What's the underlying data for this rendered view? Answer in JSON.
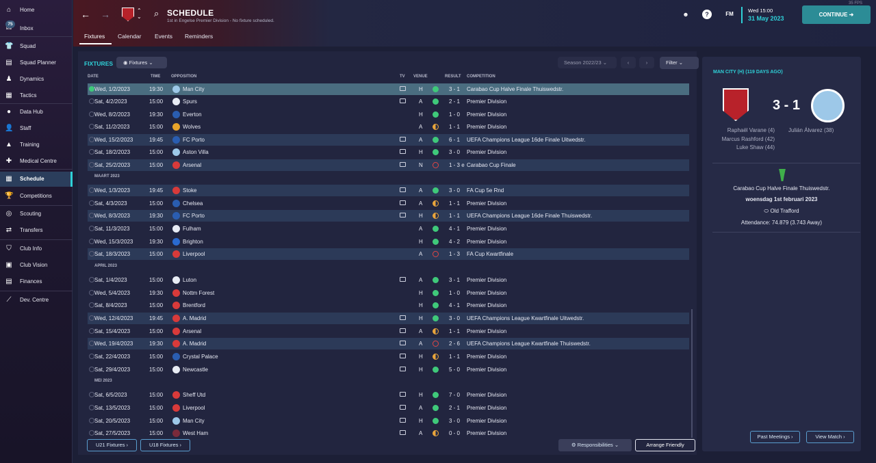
{
  "sidebar": {
    "inbox_badge": "75",
    "items": [
      {
        "label": "Home",
        "icon": "home-icon",
        "glyph": "⌂"
      },
      {
        "label": "Inbox",
        "icon": "inbox-icon",
        "glyph": "✉"
      },
      {
        "label": "Squad",
        "icon": "shirt-icon",
        "glyph": "👕"
      },
      {
        "label": "Squad Planner",
        "icon": "planner-icon",
        "glyph": "▤"
      },
      {
        "label": "Dynamics",
        "icon": "dynamics-icon",
        "glyph": "♟"
      },
      {
        "label": "Tactics",
        "icon": "tactics-icon",
        "glyph": "▦"
      },
      {
        "label": "Data Hub",
        "icon": "data-hub-icon",
        "glyph": "●"
      },
      {
        "label": "Staff",
        "icon": "staff-icon",
        "glyph": "👤"
      },
      {
        "label": "Training",
        "icon": "training-icon",
        "glyph": "▲"
      },
      {
        "label": "Medical Centre",
        "icon": "medical-icon",
        "glyph": "✚"
      },
      {
        "label": "Schedule",
        "icon": "calendar-icon",
        "glyph": "▦"
      },
      {
        "label": "Competitions",
        "icon": "trophy-icon",
        "glyph": "🏆"
      },
      {
        "label": "Scouting",
        "icon": "scouting-icon",
        "glyph": "◎"
      },
      {
        "label": "Transfers",
        "icon": "transfers-icon",
        "glyph": "⇄"
      },
      {
        "label": "Club Info",
        "icon": "shield-icon",
        "glyph": "⛉"
      },
      {
        "label": "Club Vision",
        "icon": "vision-icon",
        "glyph": "▣"
      },
      {
        "label": "Finances",
        "icon": "finances-icon",
        "glyph": "▤"
      },
      {
        "label": "Dev. Centre",
        "icon": "dev-centre-icon",
        "glyph": "⟋"
      }
    ]
  },
  "header": {
    "title": "SCHEDULE",
    "subtitle": "1st in Engelse Premier Division - No fixture scheduled.",
    "tabs": [
      "Fixtures",
      "Calendar",
      "Events",
      "Reminders"
    ],
    "date_day": "Wed 15:00",
    "date_full": "31 May 2023",
    "continue_label": "CONTINUE",
    "fps": "35 FPS",
    "fm_label": "FM",
    "help_label": "?"
  },
  "fixtures": {
    "section_title": "FIXTURES",
    "view_select": "Fixtures",
    "season_select": "Season 2022/23",
    "filter_label": "Filter",
    "columns": {
      "date": "DATE",
      "time": "TIME",
      "opposition": "OPPOSITION",
      "tv": "TV",
      "venue": "VENUE",
      "result": "RESULT",
      "competition": "COMPETITION"
    },
    "months": [
      "MAART 2023",
      "APRIL 2023",
      "MEI 2023"
    ],
    "rows": [
      {
        "date": "Wed, 1/2/2023",
        "time": "19:30",
        "opp": "Man City",
        "tv": true,
        "venue": "H",
        "res": "W",
        "score": "3 - 1",
        "comp": "Carabao Cup Halve Finale Thuiswedstr.",
        "color": "#9dc8e8"
      },
      {
        "date": "Sat, 4/2/2023",
        "time": "15:00",
        "opp": "Spurs",
        "tv": true,
        "venue": "A",
        "res": "W",
        "score": "2 - 1",
        "comp": "Premier Division",
        "color": "#e8ecf4"
      },
      {
        "date": "Wed, 8/2/2023",
        "time": "19:30",
        "opp": "Everton",
        "tv": false,
        "venue": "H",
        "res": "W",
        "score": "1 - 0",
        "comp": "Premier Division",
        "color": "#2a5db0"
      },
      {
        "date": "Sat, 11/2/2023",
        "time": "15:00",
        "opp": "Wolves",
        "tv": false,
        "venue": "A",
        "res": "D",
        "score": "1 - 1",
        "comp": "Premier Division",
        "color": "#e8a42a"
      },
      {
        "date": "Wed, 15/2/2023",
        "time": "19:45",
        "opp": "FC Porto",
        "tv": true,
        "venue": "A",
        "res": "W",
        "score": "6 - 1",
        "comp": "UEFA Champions League 16de Finale  Uitwedstr.",
        "color": "#2a5db0"
      },
      {
        "date": "Sat, 18/2/2023",
        "time": "15:00",
        "opp": "Aston Villa",
        "tv": true,
        "venue": "H",
        "res": "W",
        "score": "3 - 0",
        "comp": "Premier Division",
        "color": "#9dc8e8"
      },
      {
        "date": "Sat, 25/2/2023",
        "time": "15:00",
        "opp": "Arsenal",
        "tv": true,
        "venue": "N",
        "res": "L",
        "score": "1 - 3 e",
        "comp": "Carabao Cup Finale",
        "color": "#d83a3a"
      },
      {
        "date": "Wed, 1/3/2023",
        "time": "19:45",
        "opp": "Stoke",
        "tv": true,
        "venue": "A",
        "res": "W",
        "score": "3 - 0",
        "comp": "FA Cup 5e Rnd",
        "color": "#d83a3a"
      },
      {
        "date": "Sat, 4/3/2023",
        "time": "15:00",
        "opp": "Chelsea",
        "tv": true,
        "venue": "A",
        "res": "D",
        "score": "1 - 1",
        "comp": "Premier Division",
        "color": "#2a5db0"
      },
      {
        "date": "Wed, 8/3/2023",
        "time": "19:30",
        "opp": "FC Porto",
        "tv": true,
        "venue": "H",
        "res": "D",
        "score": "1 - 1",
        "comp": "UEFA Champions League 16de Finale  Thuiswedstr.",
        "color": "#2a5db0"
      },
      {
        "date": "Sat, 11/3/2023",
        "time": "15:00",
        "opp": "Fulham",
        "tv": false,
        "venue": "A",
        "res": "W",
        "score": "4 - 1",
        "comp": "Premier Division",
        "color": "#e8ecf4"
      },
      {
        "date": "Wed, 15/3/2023",
        "time": "19:30",
        "opp": "Brighton",
        "tv": false,
        "venue": "H",
        "res": "W",
        "score": "4 - 2",
        "comp": "Premier Division",
        "color": "#2a6ad0"
      },
      {
        "date": "Sat, 18/3/2023",
        "time": "15:00",
        "opp": "Liverpool",
        "tv": false,
        "venue": "A",
        "res": "L",
        "score": "1 - 3",
        "comp": "FA Cup Kwartfinale",
        "color": "#d83a3a"
      },
      {
        "date": "Sat, 1/4/2023",
        "time": "15:00",
        "opp": "Luton",
        "tv": true,
        "venue": "A",
        "res": "W",
        "score": "3 - 1",
        "comp": "Premier Division",
        "color": "#e8ecf4"
      },
      {
        "date": "Wed, 5/4/2023",
        "time": "19:30",
        "opp": "Nottm Forest",
        "tv": false,
        "venue": "H",
        "res": "W",
        "score": "1 - 0",
        "comp": "Premier Division",
        "color": "#d83a3a"
      },
      {
        "date": "Sat, 8/4/2023",
        "time": "15:00",
        "opp": "Brentford",
        "tv": false,
        "venue": "H",
        "res": "W",
        "score": "4 - 1",
        "comp": "Premier Division",
        "color": "#d83a3a"
      },
      {
        "date": "Wed, 12/4/2023",
        "time": "19:45",
        "opp": "A. Madrid",
        "tv": true,
        "venue": "H",
        "res": "W",
        "score": "3 - 0",
        "comp": "UEFA Champions League Kwartfinale Uitwedstr.",
        "color": "#d83a3a"
      },
      {
        "date": "Sat, 15/4/2023",
        "time": "15:00",
        "opp": "Arsenal",
        "tv": true,
        "venue": "A",
        "res": "D",
        "score": "1 - 1",
        "comp": "Premier Division",
        "color": "#d83a3a"
      },
      {
        "date": "Wed, 19/4/2023",
        "time": "19:30",
        "opp": "A. Madrid",
        "tv": true,
        "venue": "A",
        "res": "L",
        "score": "2 - 6",
        "comp": "UEFA Champions League Kwartfinale Thuiswedstr.",
        "color": "#d83a3a"
      },
      {
        "date": "Sat, 22/4/2023",
        "time": "15:00",
        "opp": "Crystal Palace",
        "tv": true,
        "venue": "H",
        "res": "D",
        "score": "1 - 1",
        "comp": "Premier Division",
        "color": "#2a5db0"
      },
      {
        "date": "Sat, 29/4/2023",
        "time": "15:00",
        "opp": "Newcastle",
        "tv": true,
        "venue": "H",
        "res": "W",
        "score": "5 - 0",
        "comp": "Premier Division",
        "color": "#e8ecf4"
      },
      {
        "date": "Sat, 6/5/2023",
        "time": "15:00",
        "opp": "Sheff Utd",
        "tv": true,
        "venue": "H",
        "res": "W",
        "score": "7 - 0",
        "comp": "Premier Division",
        "color": "#d83a3a"
      },
      {
        "date": "Sat, 13/5/2023",
        "time": "15:00",
        "opp": "Liverpool",
        "tv": true,
        "venue": "A",
        "res": "W",
        "score": "2 - 1",
        "comp": "Premier Division",
        "color": "#d83a3a"
      },
      {
        "date": "Sat, 20/5/2023",
        "time": "15:00",
        "opp": "Man City",
        "tv": true,
        "venue": "H",
        "res": "W",
        "score": "3 - 0",
        "comp": "Premier Division",
        "color": "#9dc8e8"
      },
      {
        "date": "Sat, 27/5/2023",
        "time": "15:00",
        "opp": "West Ham",
        "tv": true,
        "venue": "A",
        "res": "D",
        "score": "0 - 0",
        "comp": "Premier Division",
        "color": "#7a2a3a"
      }
    ],
    "footer": {
      "u21": "U21 Fixtures",
      "u18": "U18 Fixtures",
      "responsibilities": "Responsibilities",
      "arrange": "Arrange Friendly"
    }
  },
  "match_panel": {
    "title": "MAN CITY (H) (119 DAYS AGO)",
    "score": "3 - 1",
    "home_scorers": [
      "Raphaël Varane (4)",
      "Marcus Rashford (42)",
      "Luke Shaw (44)"
    ],
    "away_scorers": [
      "Julián Álvarez (38)"
    ],
    "competition": "Carabao Cup Halve Finale Thuiswedstr.",
    "date": "woensdag 1st februari 2023",
    "stadium": "Old Trafford",
    "attendance": "Attendance: 74.879 (3.743 Away)",
    "past_meetings": "Past Meetings",
    "view_match": "View Match"
  },
  "colors": {
    "accent": "#2fd1d8",
    "win": "#3fc97a",
    "draw": "#e9a53b",
    "loss": "#e04545"
  }
}
